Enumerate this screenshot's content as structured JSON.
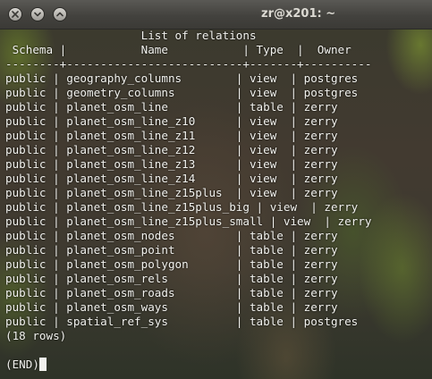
{
  "window": {
    "title": "zr@x201: ~"
  },
  "psql": {
    "header_title": "                    List of relations",
    "column_header": " Schema |           Name           | Type  |  Owner",
    "separator": "--------+--------------------------+-------+----------",
    "rows": [
      "public | geography_columns        | view  | postgres",
      "public | geometry_columns         | view  | postgres",
      "public | planet_osm_line          | table | zerry",
      "public | planet_osm_line_z10      | view  | zerry",
      "public | planet_osm_line_z11      | view  | zerry",
      "public | planet_osm_line_z12      | view  | zerry",
      "public | planet_osm_line_z13      | view  | zerry",
      "public | planet_osm_line_z14      | view  | zerry",
      "public | planet_osm_line_z15plus  | view  | zerry",
      "public | planet_osm_line_z15plus_big | view  | zerry",
      "public | planet_osm_line_z15plus_small | view  | zerry",
      "public | planet_osm_nodes         | table | zerry",
      "public | planet_osm_point         | table | zerry",
      "public | planet_osm_polygon       | table | zerry",
      "public | planet_osm_rels          | table | zerry",
      "public | planet_osm_roads         | table | zerry",
      "public | planet_osm_ways          | table | zerry",
      "public | spatial_ref_sys          | table | postgres"
    ],
    "row_count": "(18 rows)",
    "pager_prompt": "(END)"
  }
}
